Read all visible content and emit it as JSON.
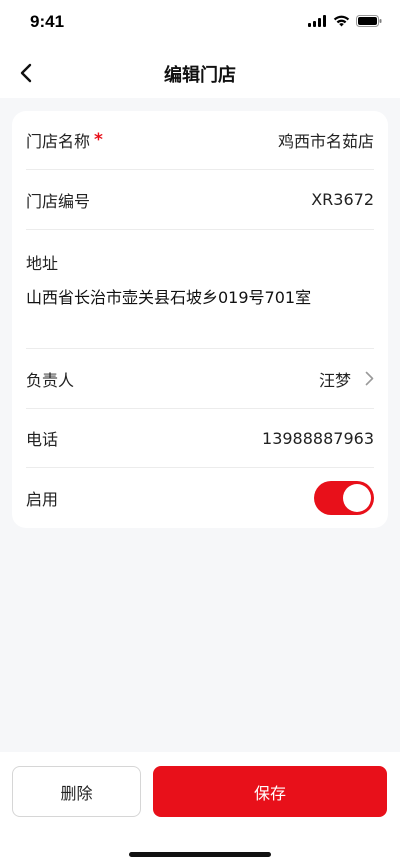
{
  "status_bar": {
    "time": "9:41"
  },
  "header": {
    "title": "编辑门店"
  },
  "form": {
    "store_name": {
      "label": "门店名称",
      "required_mark": "*",
      "value": "鸡西市名茹店"
    },
    "store_code": {
      "label": "门店编号",
      "value": "XR3672"
    },
    "address": {
      "label": "地址",
      "value": "山西省长治市壶关县石坡乡019号701室"
    },
    "manager": {
      "label": "负责人",
      "value": "汪梦"
    },
    "phone": {
      "label": "电话",
      "value": "13988887963"
    },
    "enabled": {
      "label": "启用",
      "on": true
    }
  },
  "actions": {
    "delete_label": "删除",
    "save_label": "保存"
  },
  "colors": {
    "accent": "#e8101a",
    "background": "#f6f7f9",
    "card": "#ffffff"
  },
  "icons": {
    "back": "chevron-left-icon",
    "manager_arrow": "chevron-right-icon"
  }
}
